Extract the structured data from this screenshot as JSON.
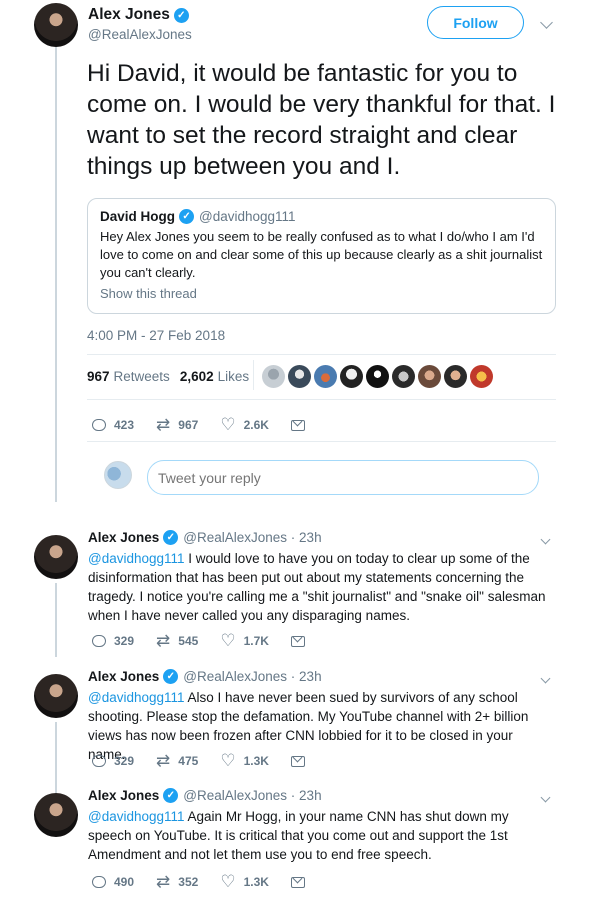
{
  "main_tweet": {
    "author_name": "Alex Jones",
    "author_handle": "@RealAlexJones",
    "follow_label": "Follow",
    "text": "Hi David, it would be fantastic for you to come on. I would be very thankful for that. I want to set the record straight and clear things up between you and I.",
    "quoted": {
      "name": "David Hogg",
      "handle": "@davidhogg111",
      "text": "Hey Alex Jones you seem to be really confused as to what I do/who I am I'd love to come on and clear some of this up because clearly as a shit journalist you can't clearly.",
      "link": "Show this thread"
    },
    "timestamp": "4:00 PM - 27 Feb 2018",
    "retweets_count": "967",
    "retweets_label": "Retweets",
    "likes_count": "2,602",
    "likes_label": "Likes",
    "actions": {
      "replies": "423",
      "retweets": "967",
      "likes": "2.6K"
    },
    "reply_placeholder": "Tweet your reply"
  },
  "replies": [
    {
      "name": "Alex Jones",
      "handle_time": "@RealAlexJones · 23h",
      "mention": "@davidhogg111",
      "text": " I would love to have you on today to clear up some of the disinformation that has been put out about my statements concerning the tragedy. I notice you're calling me a \"shit journalist\" and \"snake oil\" salesman when I have never called you any disparaging names.",
      "actions": {
        "replies": "329",
        "retweets": "545",
        "likes": "1.7K"
      }
    },
    {
      "name": "Alex Jones",
      "handle_time": "@RealAlexJones · 23h",
      "mention": "@davidhogg111",
      "text": " Also I have never been sued by survivors of any school shooting. Please stop the defamation. My YouTube channel with 2+ billion views has now been frozen after CNN lobbied for it to be closed in your name.",
      "actions": {
        "replies": "329",
        "retweets": "475",
        "likes": "1.3K"
      }
    },
    {
      "name": "Alex Jones",
      "handle_time": "@RealAlexJones · 23h",
      "mention": "@davidhogg111",
      "text": " Again Mr Hogg, in your name CNN has shut down my speech on YouTube. It is critical that you come out and support the 1st Amendment and not let them use you to end free speech.",
      "actions": {
        "replies": "490",
        "retweets": "352",
        "likes": "1.3K"
      }
    }
  ],
  "colors": {
    "accent": "#1da1f2",
    "text": "#14171a",
    "muted": "#657786",
    "border": "#ccd6dd"
  }
}
